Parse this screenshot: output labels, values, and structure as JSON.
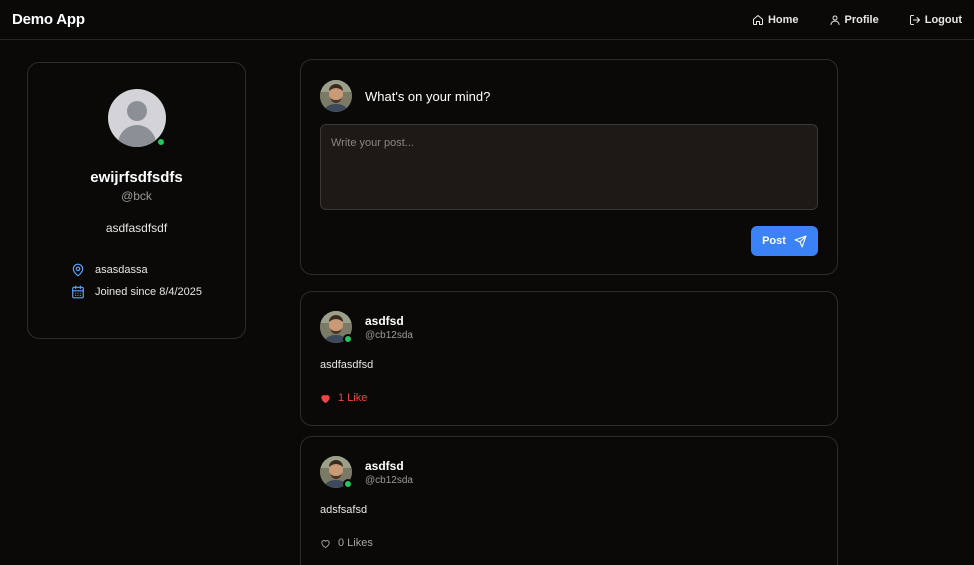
{
  "header": {
    "brand": "Demo App",
    "nav": [
      {
        "label": "Home",
        "icon": "home-icon"
      },
      {
        "label": "Profile",
        "icon": "user-icon"
      },
      {
        "label": "Logout",
        "icon": "logout-icon"
      }
    ]
  },
  "profile": {
    "name": "ewijrfsdfsdfs",
    "handle": "@bck",
    "bio": "asdfasdfsdf",
    "location": "asasdassa",
    "joined": "Joined since 8/4/2025",
    "online": true
  },
  "composer": {
    "prompt": "What's on your mind?",
    "placeholder": "Write your post...",
    "value": "",
    "post_label": "Post"
  },
  "posts": [
    {
      "author": "asdfsd",
      "handle": "@cb12sda",
      "text": "asdfasdfsd",
      "likes_label": "1 Like",
      "liked": true
    },
    {
      "author": "asdfsd",
      "handle": "@cb12sda",
      "text": "adsfsafsd",
      "likes_label": "0 Likes",
      "liked": false
    }
  ],
  "colors": {
    "background": "#0a0908",
    "accent": "#3b82f6",
    "online": "#22c55e",
    "like": "#ef4444",
    "meta_icon": "#60a5fa"
  }
}
